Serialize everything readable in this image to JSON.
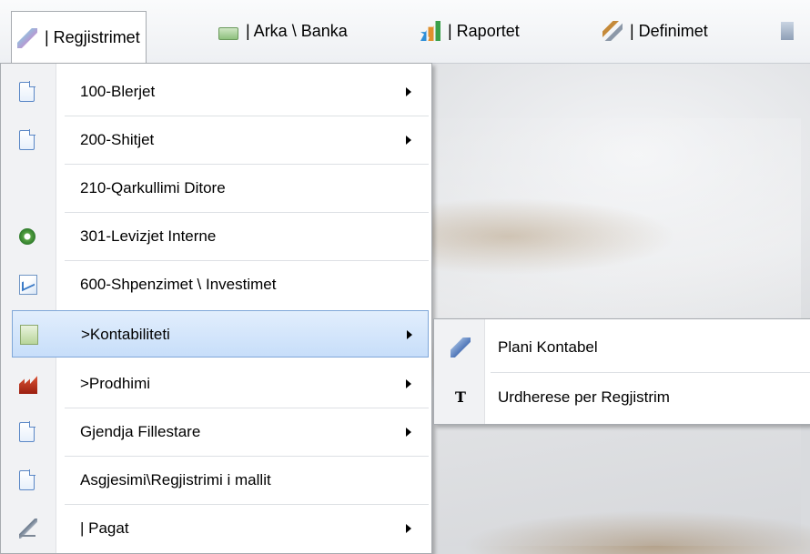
{
  "menubar": {
    "items": [
      {
        "label": "| Regjistrimet",
        "icon": "pencil-icon"
      },
      {
        "label": "| Arka \\ Banka",
        "icon": "cash-register-icon"
      },
      {
        "label": "| Raportet",
        "icon": "bar-chart-icon"
      },
      {
        "label": "| Definimet",
        "icon": "tools-icon"
      }
    ]
  },
  "dropdown": {
    "items": [
      {
        "label": "100-Blerjet",
        "icon": "document-icon",
        "has_submenu": true
      },
      {
        "label": "200-Shitjet",
        "icon": "document-icon",
        "has_submenu": true
      },
      {
        "label": "210-Qarkullimi Ditore",
        "icon": "",
        "has_submenu": false
      },
      {
        "label": "301-Levizjet Interne",
        "icon": "recycle-icon",
        "has_submenu": false
      },
      {
        "label": "600-Shpenzimet \\ Investimet",
        "icon": "chart-document-icon",
        "has_submenu": false
      },
      {
        "label": ">Kontabiliteti",
        "icon": "ledger-icon",
        "has_submenu": true,
        "highlighted": true
      },
      {
        "label": ">Prodhimi",
        "icon": "factory-icon",
        "has_submenu": true
      },
      {
        "label": "Gjendja Fillestare",
        "icon": "document-icon",
        "has_submenu": true
      },
      {
        "label": "Asgjesimi\\Regjistrimi i mallit",
        "icon": "document-icon",
        "has_submenu": false
      },
      {
        "label": "| Pagat",
        "icon": "pen-icon",
        "has_submenu": true
      }
    ]
  },
  "submenu": {
    "items": [
      {
        "label": "Plani Kontabel",
        "icon": "pencil-icon"
      },
      {
        "label": "Urdherese per Regjistrim",
        "icon": "text-t-icon"
      }
    ]
  }
}
